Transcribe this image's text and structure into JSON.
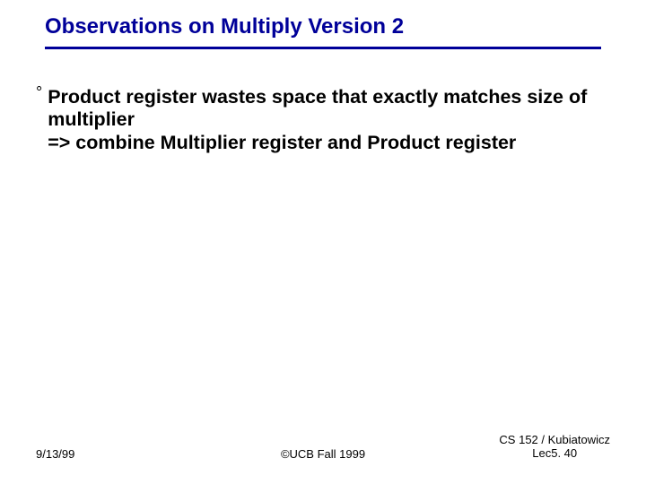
{
  "title": "Observations on Multiply Version 2",
  "bullets": [
    {
      "mark": "°",
      "text": "Product register wastes space that exactly matches size of multiplier\n=> combine Multiplier register and Product register"
    }
  ],
  "footer": {
    "left": "9/13/99",
    "center": "©UCB Fall 1999",
    "right_line1": "CS 152 / Kubiatowicz",
    "right_line2": "Lec5. 40"
  }
}
